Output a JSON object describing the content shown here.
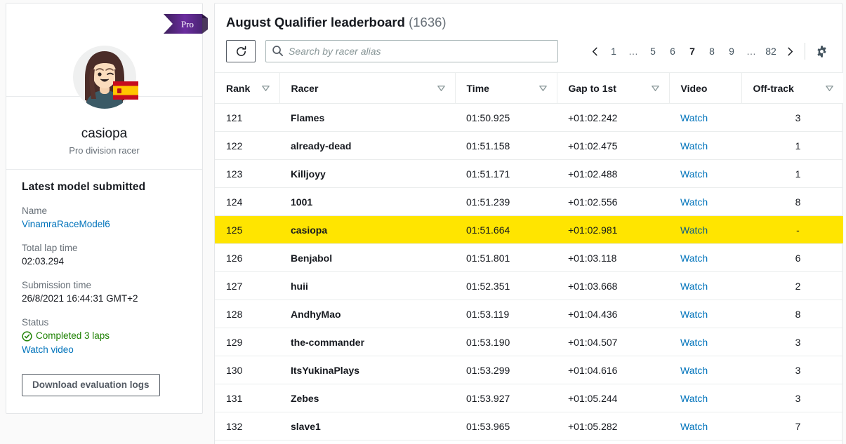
{
  "sidebar": {
    "badge": {
      "label": "Pro",
      "color": "#5a2a82"
    },
    "avatar": {
      "icon": "user-avatar-female",
      "flag": "flag-spain"
    },
    "alias": "casiopa",
    "subtitle": "Pro division racer",
    "model": {
      "heading": "Latest model submitted",
      "name_label": "Name",
      "name_value": "VinamraRaceModel6",
      "lap_label": "Total lap time",
      "lap_value": "02:03.294",
      "submission_label": "Submission time",
      "submission_value": "26/8/2021 16:44:31 GMT+2",
      "status_label": "Status",
      "status_value": "Completed 3 laps",
      "status_icon": "check-circle-icon",
      "status_color": "#1d8102",
      "watch_video_label": "Watch video",
      "download_label": "Download evaluation logs"
    }
  },
  "board": {
    "title": "August Qualifier leaderboard",
    "count": "(1636)",
    "refresh_icon": "refresh-icon",
    "search": {
      "icon": "search-icon",
      "value": "",
      "placeholder": "Search by racer alias"
    },
    "pagination": {
      "prev_icon": "chevron-left-icon",
      "next_icon": "chevron-right-icon",
      "pages": [
        "1",
        "…",
        "5",
        "6",
        "7",
        "8",
        "9",
        "…",
        "82"
      ],
      "current": "7"
    },
    "settings_icon": "gear-icon",
    "columns": [
      {
        "label": "Rank",
        "sortable": true
      },
      {
        "label": "Racer",
        "sortable": true
      },
      {
        "label": "Time",
        "sortable": true
      },
      {
        "label": "Gap to 1st",
        "sortable": true
      },
      {
        "label": "Video",
        "sortable": false
      },
      {
        "label": "Off-track",
        "sortable": true
      }
    ],
    "watch_label": "Watch",
    "highlight_color": "#ffe500",
    "rows": [
      {
        "rank": "121",
        "racer": "Flames",
        "time": "01:50.925",
        "gap": "+01:02.242",
        "video": "Watch",
        "offtrack": "3",
        "highlighted": false
      },
      {
        "rank": "122",
        "racer": "already-dead",
        "time": "01:51.158",
        "gap": "+01:02.475",
        "video": "Watch",
        "offtrack": "1",
        "highlighted": false
      },
      {
        "rank": "123",
        "racer": "Killjoyy",
        "time": "01:51.171",
        "gap": "+01:02.488",
        "video": "Watch",
        "offtrack": "1",
        "highlighted": false
      },
      {
        "rank": "124",
        "racer": "1001",
        "time": "01:51.239",
        "gap": "+01:02.556",
        "video": "Watch",
        "offtrack": "8",
        "highlighted": false
      },
      {
        "rank": "125",
        "racer": "casiopa",
        "time": "01:51.664",
        "gap": "+01:02.981",
        "video": "Watch",
        "offtrack": "-",
        "highlighted": true
      },
      {
        "rank": "126",
        "racer": "Benjabol",
        "time": "01:51.801",
        "gap": "+01:03.118",
        "video": "Watch",
        "offtrack": "6",
        "highlighted": false
      },
      {
        "rank": "127",
        "racer": "huii",
        "time": "01:52.351",
        "gap": "+01:03.668",
        "video": "Watch",
        "offtrack": "2",
        "highlighted": false
      },
      {
        "rank": "128",
        "racer": "AndhyMao",
        "time": "01:53.119",
        "gap": "+01:04.436",
        "video": "Watch",
        "offtrack": "8",
        "highlighted": false
      },
      {
        "rank": "129",
        "racer": "the-commander",
        "time": "01:53.190",
        "gap": "+01:04.507",
        "video": "Watch",
        "offtrack": "3",
        "highlighted": false
      },
      {
        "rank": "130",
        "racer": "ItsYukinaPlays",
        "time": "01:53.299",
        "gap": "+01:04.616",
        "video": "Watch",
        "offtrack": "3",
        "highlighted": false
      },
      {
        "rank": "131",
        "racer": "Zebes",
        "time": "01:53.927",
        "gap": "+01:05.244",
        "video": "Watch",
        "offtrack": "3",
        "highlighted": false
      },
      {
        "rank": "132",
        "racer": "slave1",
        "time": "01:53.965",
        "gap": "+01:05.282",
        "video": "Watch",
        "offtrack": "7",
        "highlighted": false
      }
    ]
  }
}
